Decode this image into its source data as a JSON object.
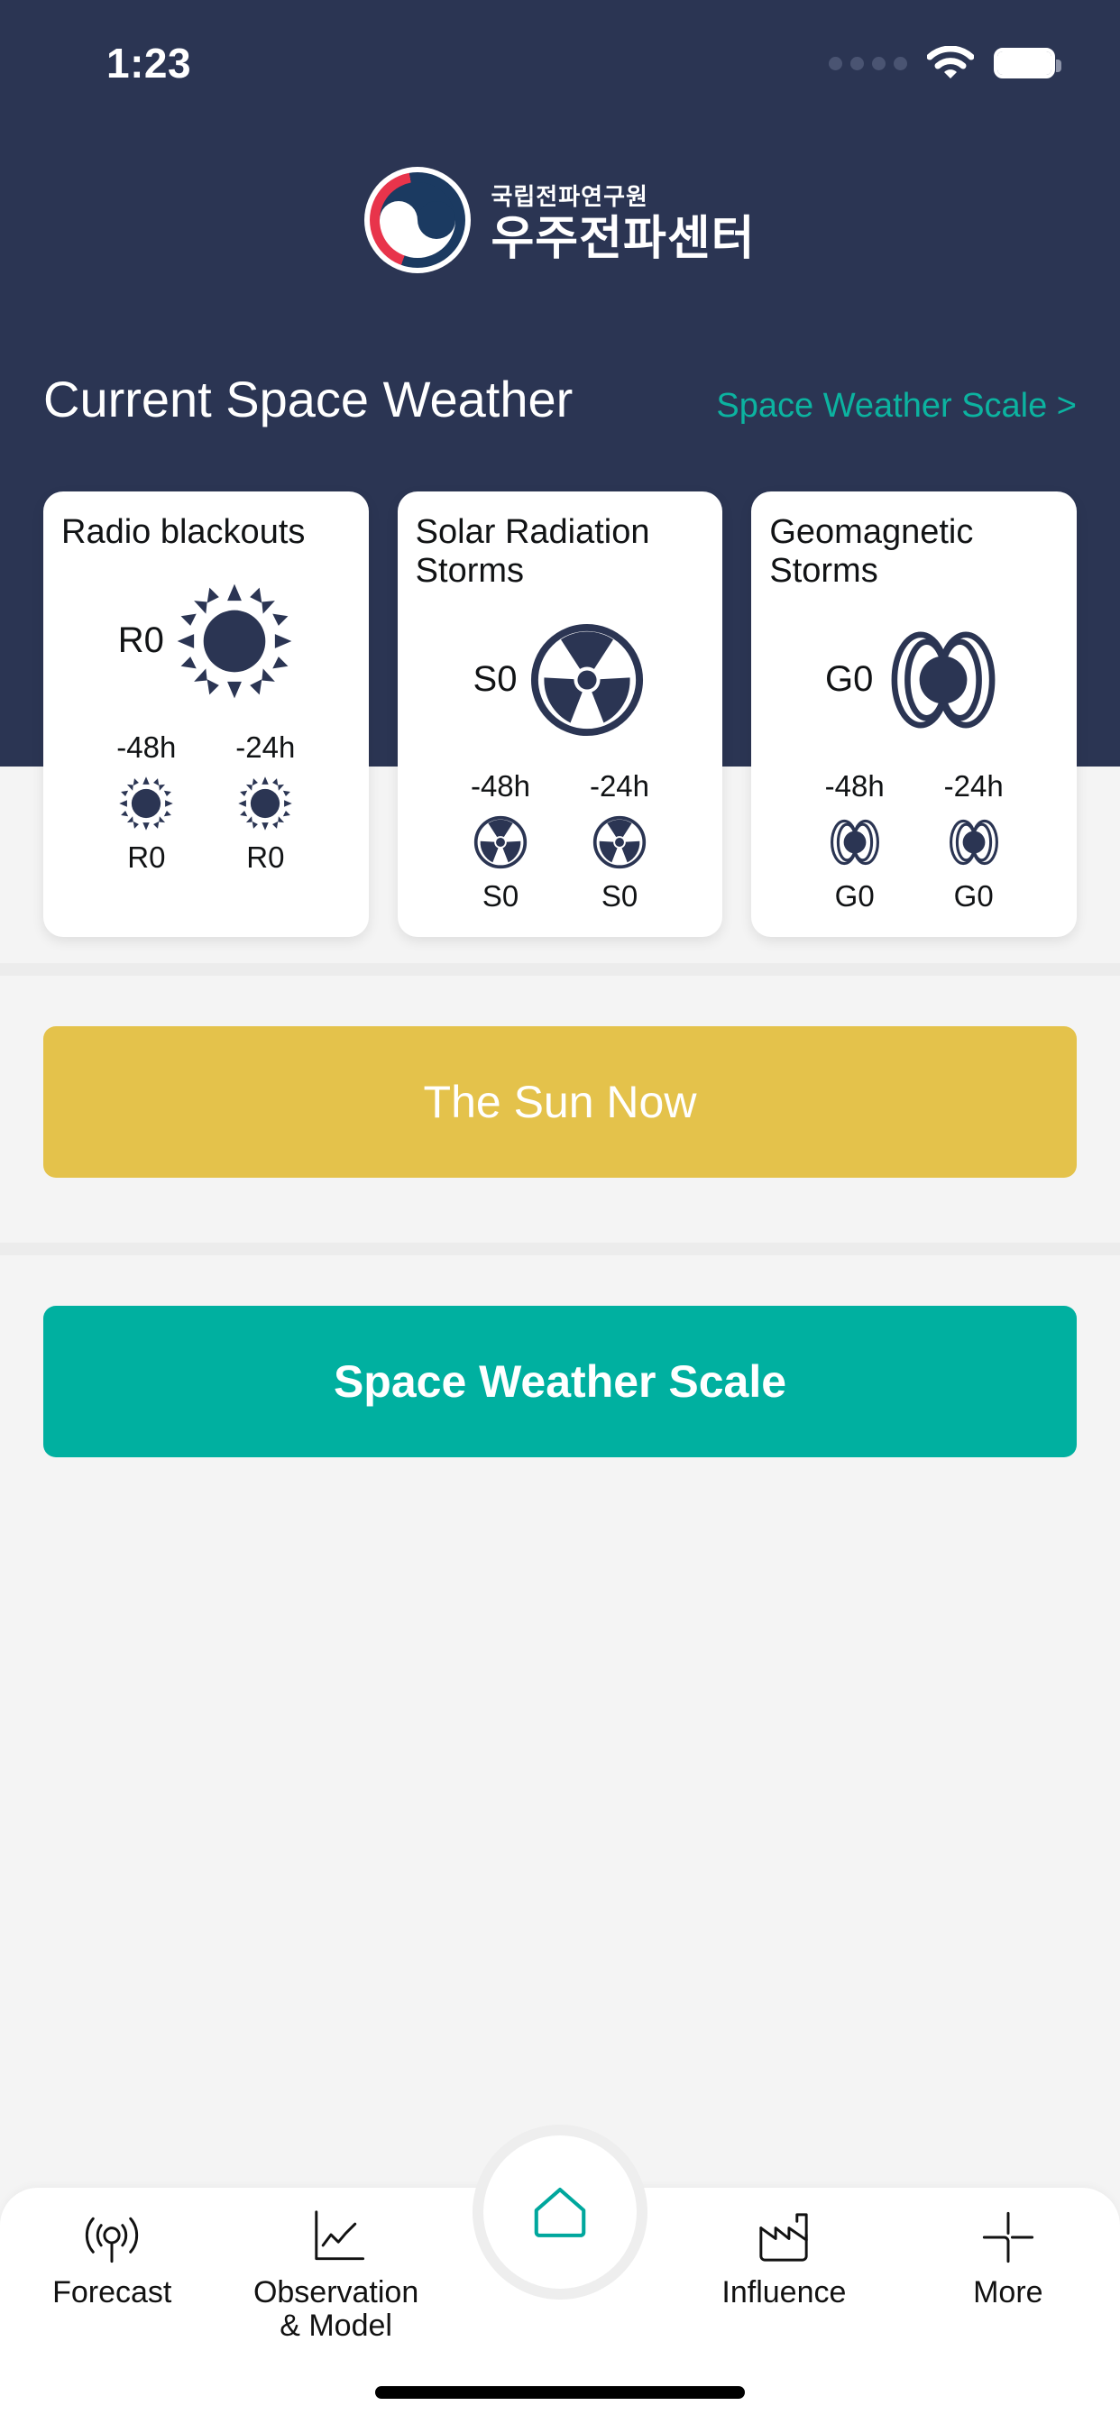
{
  "status_bar": {
    "time": "1:23",
    "signal_icon": "signal-dots-icon",
    "wifi_icon": "wifi-icon",
    "battery_icon": "battery-full-icon"
  },
  "brand": {
    "logo_icon": "korea-government-taegeuk-logo",
    "agency_name": "국립전파연구원",
    "center_name": "우주전파센터"
  },
  "header": {
    "title": "Current Space Weather",
    "scale_link": "Space Weather Scale >"
  },
  "cards": [
    {
      "title": "Radio blackouts",
      "icon": "sun-icon",
      "current_level": "R0",
      "history_headers": [
        "-48h",
        "-24h"
      ],
      "history_levels": [
        "R0",
        "R0"
      ]
    },
    {
      "title": "Solar Radiation Storms",
      "icon": "radiation-icon",
      "current_level": "S0",
      "history_headers": [
        "-48h",
        "-24h"
      ],
      "history_levels": [
        "S0",
        "S0"
      ]
    },
    {
      "title": "Geomagnetic Storms",
      "icon": "magnetosphere-icon",
      "current_level": "G0",
      "history_headers": [
        "-48h",
        "-24h"
      ],
      "history_levels": [
        "G0",
        "G0"
      ]
    }
  ],
  "buttons": {
    "sun_now": "The Sun Now",
    "space_weather_scale": "Space Weather Scale"
  },
  "bottom_nav": {
    "items": [
      {
        "label": "Forecast",
        "icon": "broadcast-antenna-icon"
      },
      {
        "label": "Observation\n& Model",
        "label_line1": "Observation",
        "label_line2": "& Model",
        "icon": "line-chart-icon"
      },
      {
        "label": "Influence",
        "icon": "factory-icon"
      },
      {
        "label": "More",
        "icon": "crosshair-plus-icon"
      }
    ],
    "home_button": {
      "icon": "home-icon",
      "active": true
    }
  },
  "colors": {
    "header_bg": "#2b3553",
    "accent_teal": "#00b0a0",
    "link_teal": "#0cb3a0",
    "sun_button": "#e4c24b",
    "icon_navy": "#2b3553",
    "page_bg": "#f4f4f4"
  }
}
